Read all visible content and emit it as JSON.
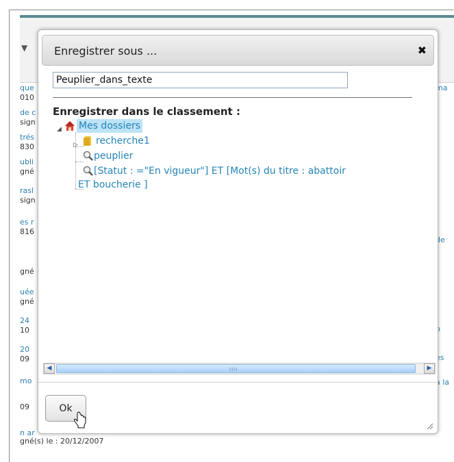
{
  "dialog": {
    "title": "Enregistrer sous ...",
    "close_glyph": "✖",
    "name_value": "Peuplier_dans_texte",
    "folder_label": "Enregistrer dans le classement :",
    "tree": {
      "root": {
        "label": "Mes dossiers",
        "icon": "home-icon",
        "selected": true
      },
      "children": [
        {
          "label": "recherche1",
          "icon": "folder-icon"
        },
        {
          "label": "peuplier",
          "icon": "search-icon"
        },
        {
          "label_line1": "[Statut : =\"En vigueur\"] ET [Mot(s) du titre : abattoir",
          "label_line2": "ET boucherie ]",
          "icon": "search-icon"
        }
      ]
    },
    "scrollbar": {
      "left_arrow": "◀",
      "right_arrow": "▶",
      "grip": "IIII"
    },
    "ok_label": "Ok"
  },
  "background": {
    "left_rows": [
      {
        "a": "que",
        "b": "010"
      },
      {
        "a": "de c",
        "b": "sign"
      },
      {
        "a": "trés",
        "b": "830"
      },
      {
        "a": "ubli",
        "b": "gné"
      },
      {
        "a": "rasl",
        "b": "sign"
      },
      {
        "a": "es r",
        "b": "816"
      },
      {
        "a": "",
        "b": "gné"
      },
      {
        "a": "uée",
        "b": "gné"
      },
      {
        "a": "24",
        "b": "10"
      },
      {
        "a": "20",
        "b": "09"
      },
      {
        "a": "mo",
        "b": ""
      },
      {
        "a": "",
        "b": "09"
      },
      {
        "a": "n ar",
        "b": ""
      }
    ],
    "right_rows": [
      {
        "a": "ma"
      },
      {
        "a": "de"
      },
      {
        "a": "b"
      },
      {
        "a": "es"
      },
      {
        "a": "à la"
      }
    ],
    "bottom_text": "gné(s) le : 20/12/2007"
  },
  "colors": {
    "accent": "#2583b8",
    "selection": "#bde3f7",
    "stripe": "#5a8a92"
  }
}
